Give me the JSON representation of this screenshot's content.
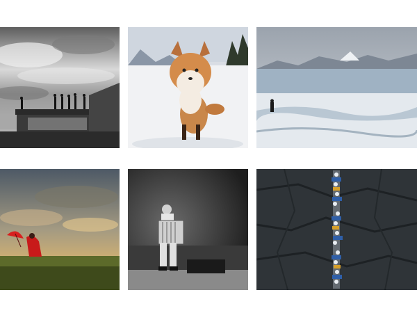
{
  "gallery": {
    "photos": [
      {
        "icon": "bw-pier-silhouettes-photo"
      },
      {
        "icon": "fox-in-snow-photo"
      },
      {
        "icon": "glacier-hiker-photo"
      },
      {
        "icon": "red-umbrella-field-photo"
      },
      {
        "icon": "accordion-player-photo"
      },
      {
        "icon": "climbers-on-cliff-photo"
      }
    ]
  }
}
